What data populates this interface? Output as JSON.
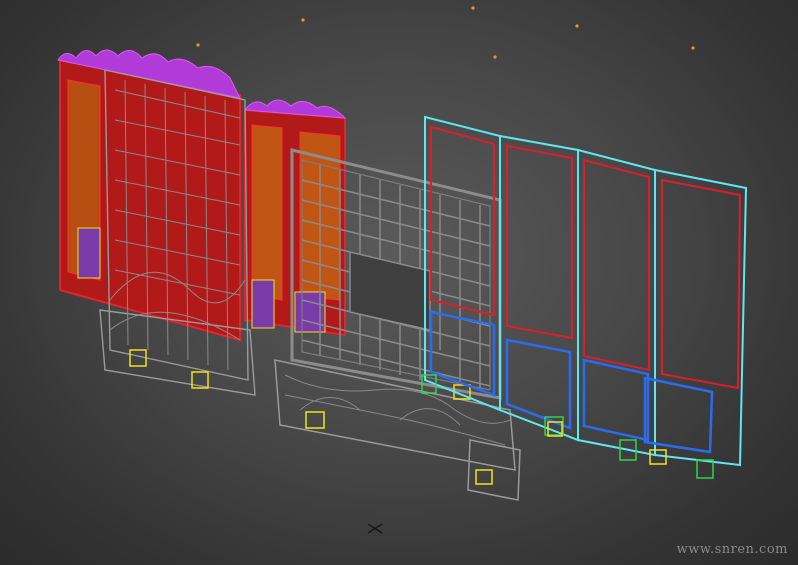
{
  "viewport": {
    "label": "",
    "watermark": "www.snren.com",
    "colors": {
      "background": "#3f3f3f",
      "wire_red": "#d8202a",
      "wire_cyan": "#5fe6f0",
      "wire_blue": "#2a6cf0",
      "wire_gray": "#8a8a8a",
      "wire_orange": "#c7651c",
      "wire_purple": "#b23ad8",
      "wire_yellow": "#f2e21c",
      "wire_green": "#33d44a",
      "light_marker": "#e69a2a"
    }
  }
}
